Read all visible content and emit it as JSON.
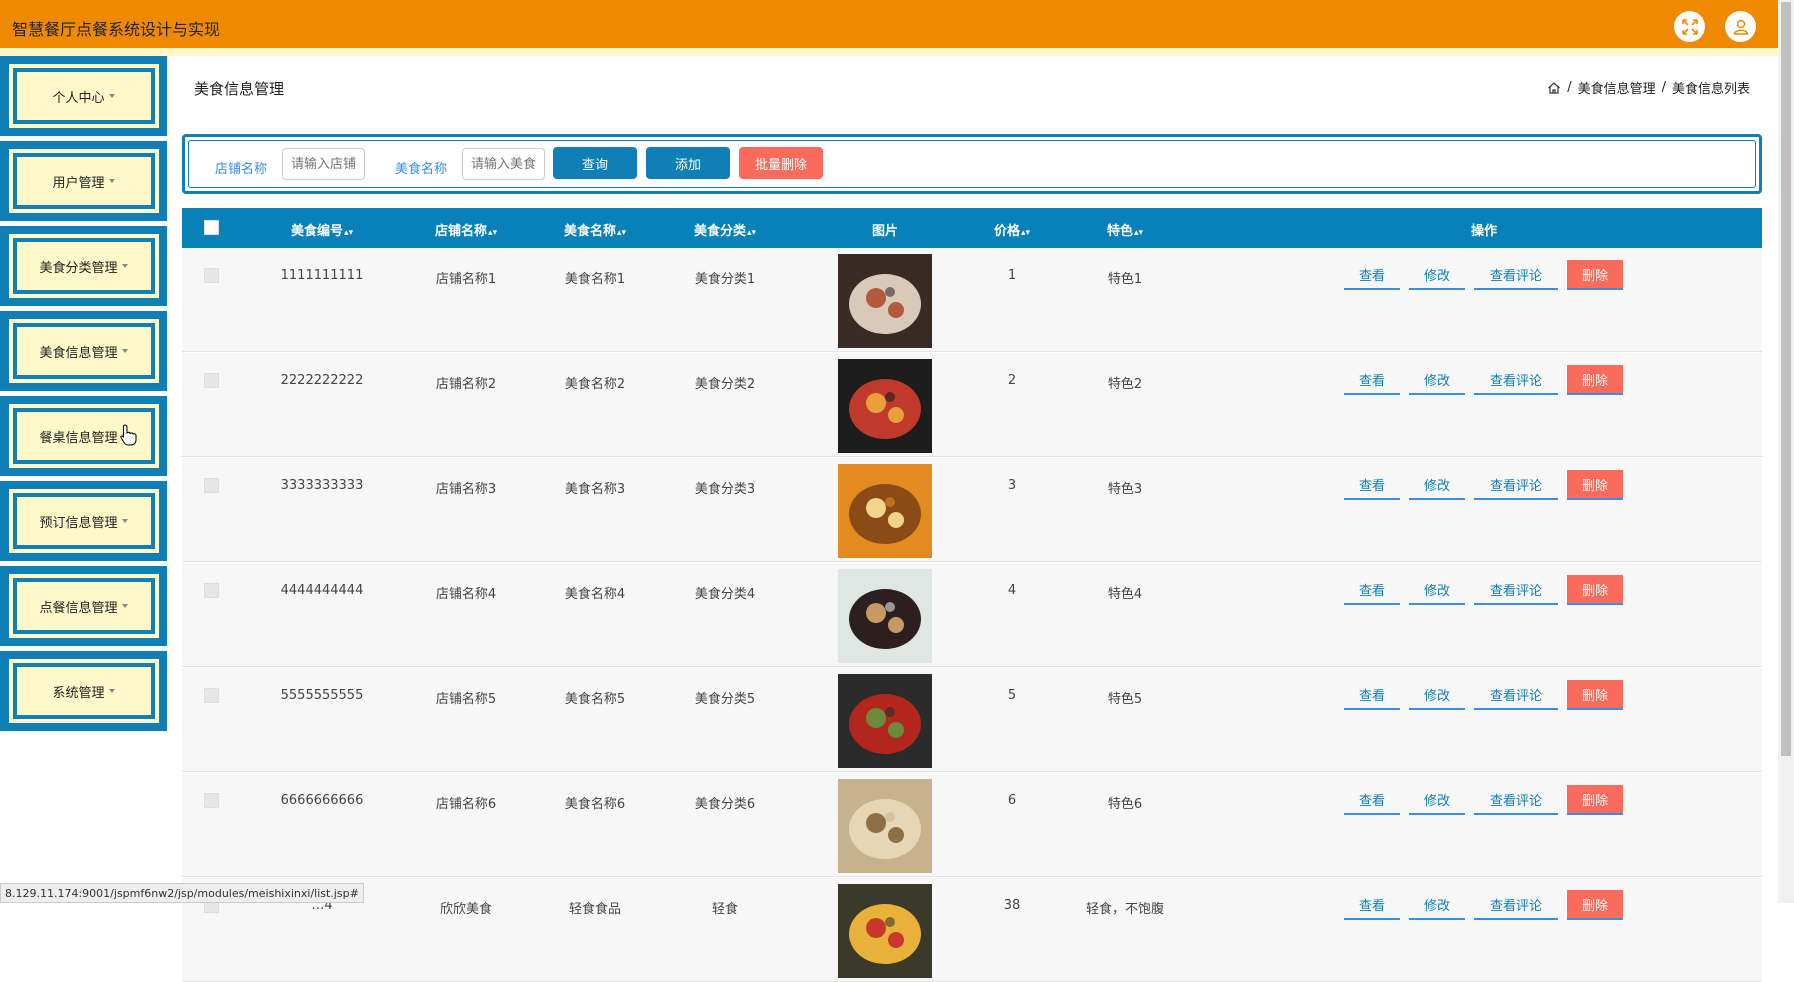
{
  "app": {
    "title": "智慧餐厅点餐系统设计与实现"
  },
  "header_icons": [
    "fullscreen-icon",
    "user-icon"
  ],
  "sidebar": {
    "items": [
      {
        "label": "个人中心"
      },
      {
        "label": "用户管理"
      },
      {
        "label": "美食分类管理"
      },
      {
        "label": "美食信息管理"
      },
      {
        "label": "餐桌信息管理"
      },
      {
        "label": "预订信息管理"
      },
      {
        "label": "点餐信息管理"
      },
      {
        "label": "系统管理"
      }
    ]
  },
  "page": {
    "title": "美食信息管理",
    "breadcrumb": {
      "section": "美食信息管理",
      "separator": "/",
      "current": "美食信息列表"
    }
  },
  "search": {
    "shop_label": "店铺名称",
    "shop_placeholder": "请输入店铺名称",
    "food_label": "美食名称",
    "food_placeholder": "请输入美食名称",
    "query_button": "查询",
    "add_button": "添加",
    "batch_delete_button": "批量删除"
  },
  "table": {
    "columns": [
      "美食编号",
      "店铺名称",
      "美食名称",
      "美食分类",
      "图片",
      "价格",
      "特色",
      "操作"
    ],
    "actions": {
      "view": "查看",
      "edit": "修改",
      "comments": "查看评论",
      "delete": "删除"
    },
    "rows": [
      {
        "id": "1111111111",
        "shop": "店铺名称1",
        "name": "美食名称1",
        "category": "美食分类1",
        "price": "1",
        "feature": "特色1"
      },
      {
        "id": "2222222222",
        "shop": "店铺名称2",
        "name": "美食名称2",
        "category": "美食分类2",
        "price": "2",
        "feature": "特色2"
      },
      {
        "id": "3333333333",
        "shop": "店铺名称3",
        "name": "美食名称3",
        "category": "美食分类3",
        "price": "3",
        "feature": "特色3"
      },
      {
        "id": "4444444444",
        "shop": "店铺名称4",
        "name": "美食名称4",
        "category": "美食分类4",
        "price": "4",
        "feature": "特色4"
      },
      {
        "id": "5555555555",
        "shop": "店铺名称5",
        "name": "美食名称5",
        "category": "美食分类5",
        "price": "5",
        "feature": "特色5"
      },
      {
        "id": "6666666666",
        "shop": "店铺名称6",
        "name": "美食名称6",
        "category": "美食分类6",
        "price": "6",
        "feature": "特色6"
      },
      {
        "id": "…4",
        "shop": "欣欣美食",
        "name": "轻食食品",
        "category": "轻食",
        "price": "38",
        "feature": "轻食，不饱腹"
      }
    ]
  },
  "status_bar": {
    "url": "8.129.11.174:9001/jspmf6nw2/jsp/modules/meishixinxi/list.jsp#"
  },
  "colors": {
    "header": "#ef8a00",
    "primary": "#107fb5",
    "danger": "#fb6b5b",
    "menu_bg": "#fff8c9"
  }
}
